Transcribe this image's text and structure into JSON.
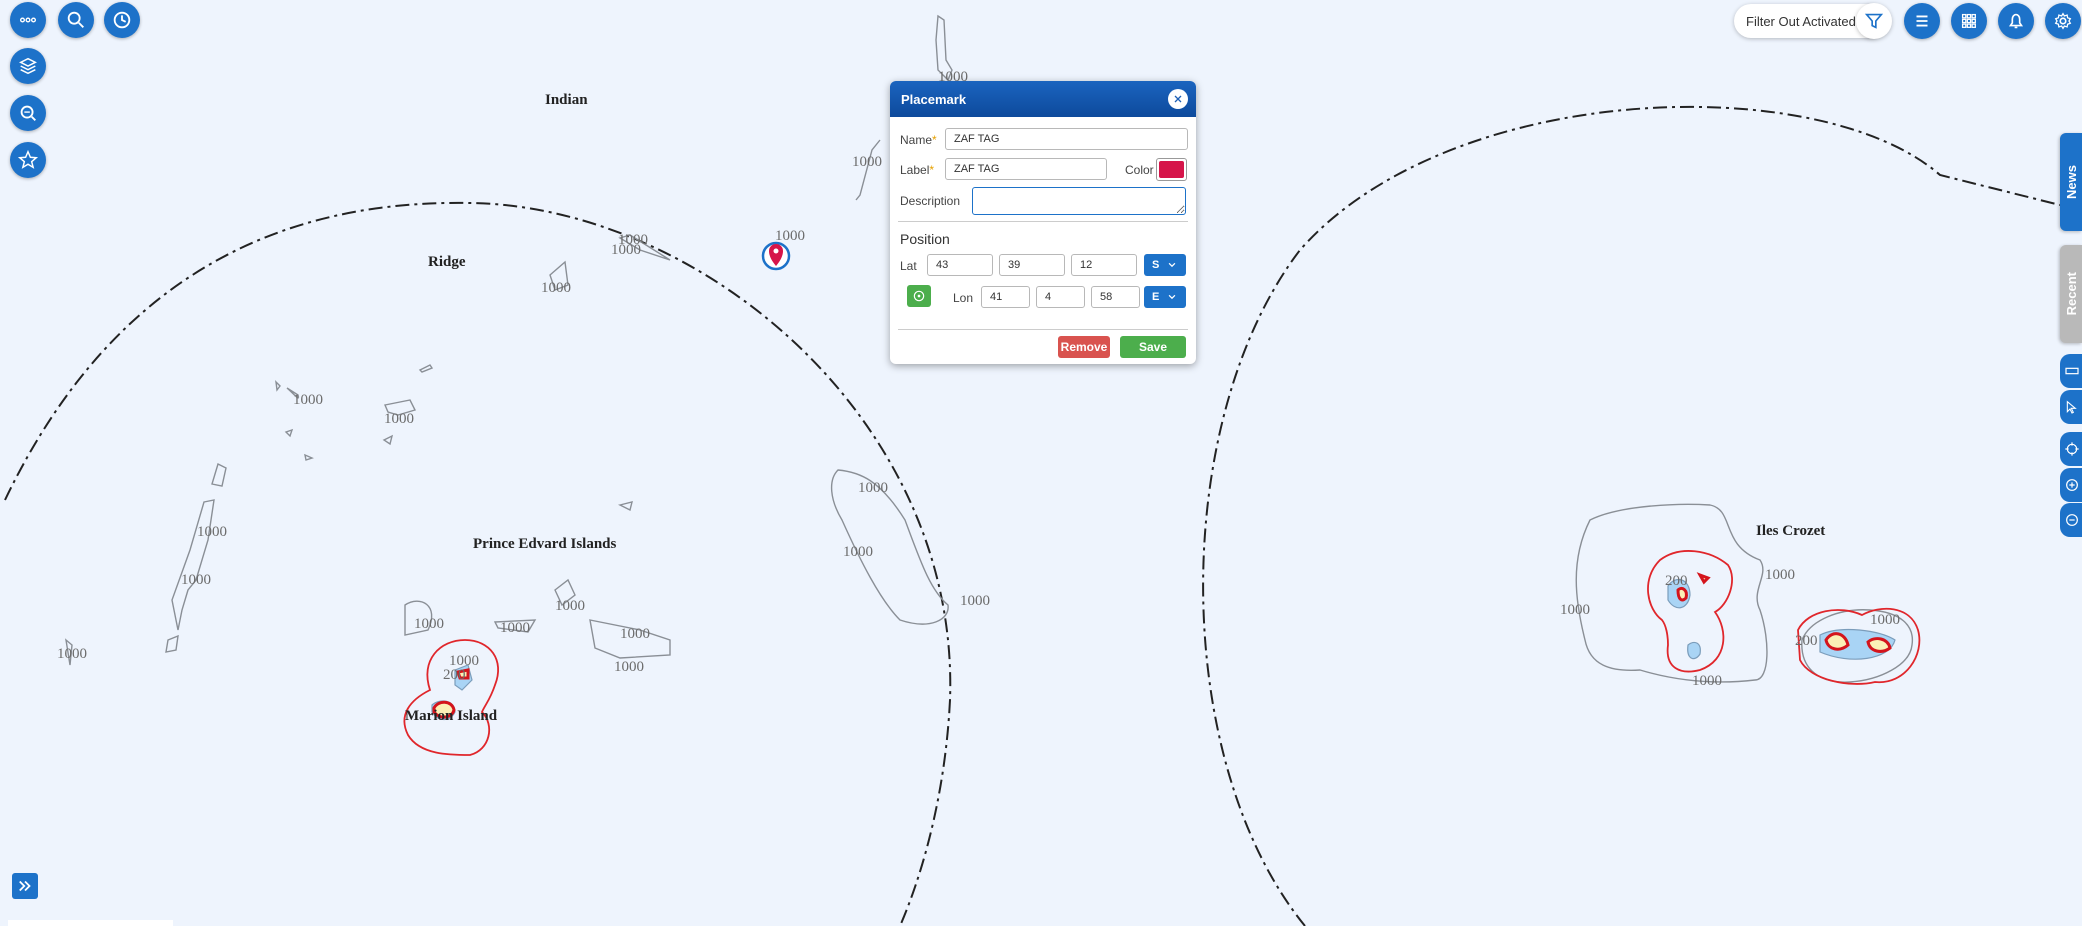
{
  "toolbar_left": {
    "more": "more-icon",
    "search": "search-icon",
    "history": "clock-icon",
    "layers": "layers-icon",
    "zoom_search": "zoom-search-icon",
    "favorites": "star-icon"
  },
  "toolbar_right": {
    "filter_status": "Filter Out Activated",
    "icons": [
      "filter-icon",
      "list-icon",
      "grid-icon",
      "bell-icon",
      "gear-icon"
    ]
  },
  "side_tabs": {
    "news": "News",
    "recent": "Recent"
  },
  "map": {
    "labels": {
      "indian": "Indian",
      "ridge": "Ridge",
      "prince_edward": "Prince Edvard Islands",
      "marion": "Marion Island",
      "crozet": "Iles Crozet"
    },
    "depth_major": "1000",
    "depth_minor": "200"
  },
  "placemark": {
    "title": "Placemark",
    "name_label": "Name",
    "name_value": "ZAF TAG",
    "label_label": "Label",
    "label_value": "ZAF TAG",
    "color_label": "Color",
    "color_value": "#d6154a",
    "description_label": "Description",
    "description_value": "",
    "position_heading": "Position",
    "lat_label": "Lat",
    "lat_deg": "43",
    "lat_min": "39",
    "lat_sec": "12",
    "lat_hemi": "S",
    "lon_label": "Lon",
    "lon_deg": "41",
    "lon_min": "4",
    "lon_sec": "58",
    "lon_hemi": "E",
    "remove_label": "Remove",
    "save_label": "Save"
  },
  "colors": {
    "accent": "#1d72c9",
    "remove": "#d9534f",
    "save": "#4cae4c",
    "boundary": "#e0262b"
  }
}
